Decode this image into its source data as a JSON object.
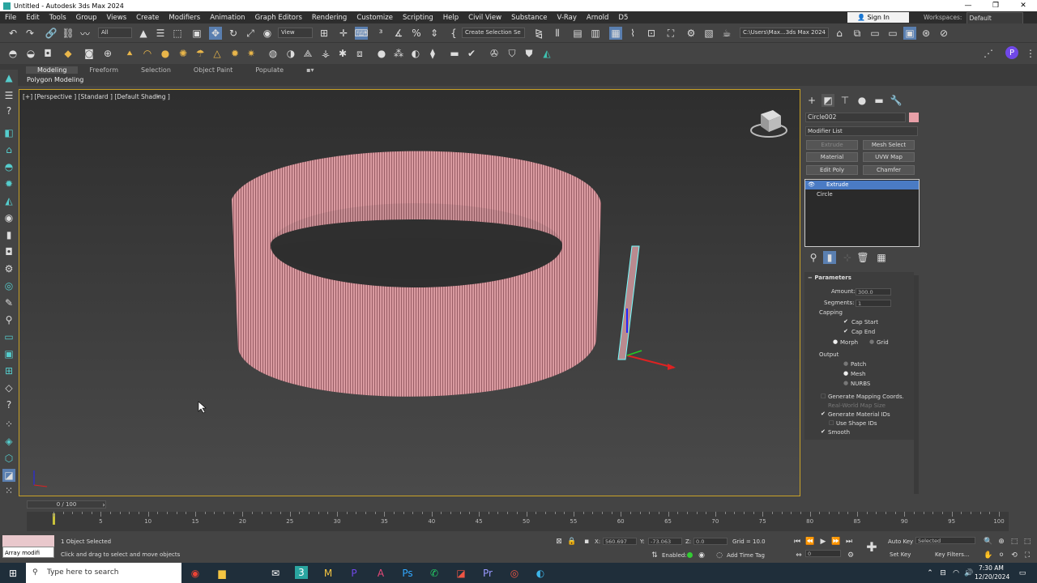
{
  "window": {
    "title": "Untitled - Autodesk 3ds Max 2024",
    "controls": [
      "—",
      "❐",
      "✕"
    ]
  },
  "menu": [
    "File",
    "Edit",
    "Tools",
    "Group",
    "Views",
    "Create",
    "Modifiers",
    "Animation",
    "Graph Editors",
    "Rendering",
    "Customize",
    "Scripting",
    "Help",
    "Civil View",
    "Substance",
    "V-Ray",
    "Arnold",
    "D5"
  ],
  "signin": {
    "label": "Sign In"
  },
  "workspaces": {
    "label": "Workspaces:",
    "value": "Default"
  },
  "toolbar": {
    "filter": "All",
    "ref_coord": "View",
    "selection_set": "Create Selection Se",
    "project_path": "C:\\Users\\Max...3ds Max 2024"
  },
  "ribbon": {
    "tabs": [
      "Modeling",
      "Freeform",
      "Selection",
      "Object Paint",
      "Populate"
    ],
    "active_tab": "Modeling",
    "subpanel": "Polygon Modeling"
  },
  "viewport": {
    "label": "[+] [Perspective ] [Standard ] [Default Shading ]"
  },
  "command_panel": {
    "object_name": "Circle002",
    "object_color": "#e8a0a8",
    "modifier_list": "Modifier List",
    "modifier_buttons": [
      "Extrude",
      "Mesh Select",
      "Material",
      "UVW Map",
      "Edit Poly",
      "Chamfer"
    ],
    "stack": [
      "Extrude",
      "Circle"
    ],
    "parameters": {
      "title": "Parameters",
      "amount_label": "Amount:",
      "amount": "300.0",
      "segments_label": "Segments:",
      "segments": "1",
      "capping_label": "Capping",
      "cap_start": "Cap Start",
      "cap_end": "Cap End",
      "morph": "Morph",
      "grid": "Grid",
      "output_label": "Output",
      "patch": "Patch",
      "mesh": "Mesh",
      "nurbs": "NURBS",
      "gen_mapping": "Generate Mapping Coords.",
      "real_world": "Real-World Map Size",
      "gen_matids": "Generate Material IDs",
      "use_shape_ids": "Use Shape IDs",
      "smooth": "Smooth"
    }
  },
  "timeline": {
    "frame": "0 / 100",
    "ticks": [
      "0",
      "5",
      "10",
      "15",
      "20",
      "25",
      "30",
      "35",
      "40",
      "45",
      "50",
      "55",
      "60",
      "65",
      "70",
      "75",
      "80",
      "85",
      "90",
      "95",
      "100"
    ]
  },
  "status": {
    "maxscript": "Array modifi",
    "selected": "1 Object Selected",
    "prompt": "Click and drag to select and move objects",
    "x_label": "X:",
    "x": "560.697",
    "y_label": "Y:",
    "y": "-73.063",
    "z_label": "Z:",
    "z": "0.0",
    "grid": "Grid = 10.0",
    "enabled": "Enabled:",
    "add_time_tag": "Add Time Tag",
    "auto_key": "Auto Key",
    "set_key": "Set Key",
    "selected_dd": "Selected",
    "key_filters": "Key Filters...",
    "frame_field": "0"
  },
  "taskbar": {
    "search": "Type here to search",
    "time": "7:30 AM",
    "date": "12/20/2024"
  }
}
